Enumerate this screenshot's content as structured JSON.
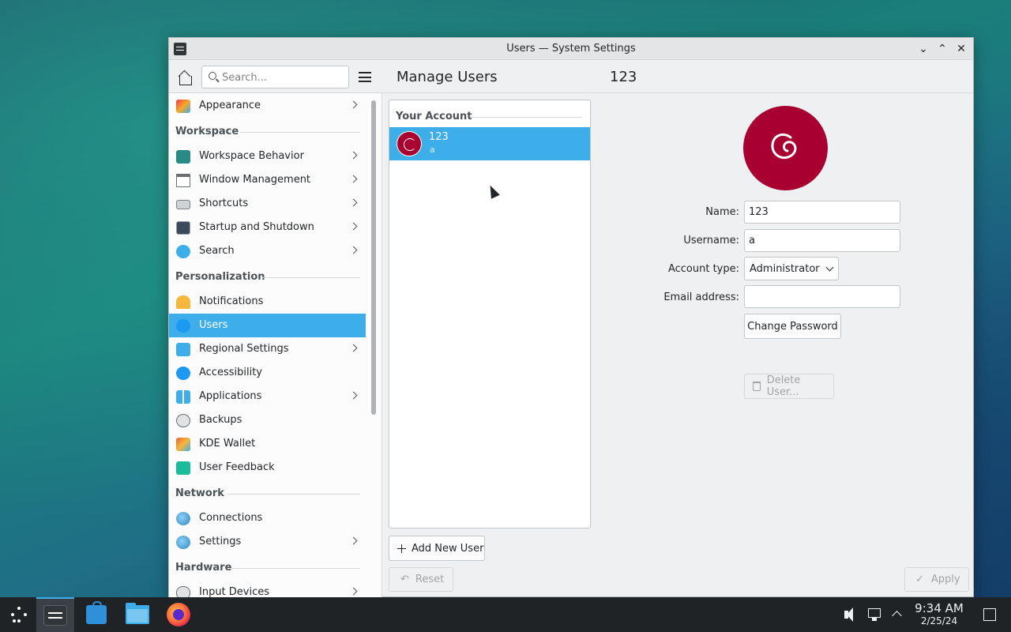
{
  "window": {
    "title": "Users — System Settings",
    "controls": [
      "minimize",
      "maximize",
      "close"
    ]
  },
  "sidebar": {
    "search_placeholder": "Search...",
    "top_items": [
      {
        "label": "Appearance",
        "has_submenu": true
      }
    ],
    "categories": [
      {
        "name": "Workspace",
        "items": [
          {
            "label": "Workspace Behavior",
            "has_submenu": true
          },
          {
            "label": "Window Management",
            "has_submenu": true
          },
          {
            "label": "Shortcuts",
            "has_submenu": true
          },
          {
            "label": "Startup and Shutdown",
            "has_submenu": true
          },
          {
            "label": "Search",
            "has_submenu": true
          }
        ]
      },
      {
        "name": "Personalization",
        "items": [
          {
            "label": "Notifications",
            "has_submenu": false
          },
          {
            "label": "Users",
            "has_submenu": false,
            "selected": true
          },
          {
            "label": "Regional Settings",
            "has_submenu": true
          },
          {
            "label": "Accessibility",
            "has_submenu": false
          },
          {
            "label": "Applications",
            "has_submenu": true
          },
          {
            "label": "Backups",
            "has_submenu": false
          },
          {
            "label": "KDE Wallet",
            "has_submenu": false
          },
          {
            "label": "User Feedback",
            "has_submenu": false
          }
        ]
      },
      {
        "name": "Network",
        "items": [
          {
            "label": "Connections",
            "has_submenu": false
          },
          {
            "label": "Settings",
            "has_submenu": true
          }
        ]
      },
      {
        "name": "Hardware",
        "items": [
          {
            "label": "Input Devices",
            "has_submenu": true
          }
        ]
      }
    ]
  },
  "header": {
    "title": "Manage Users",
    "subtitle": "123"
  },
  "user_list": {
    "section_label": "Your Account",
    "users": [
      {
        "name": "123",
        "username": "a",
        "selected": true
      }
    ],
    "add_button": "Add New User"
  },
  "details": {
    "name_label": "Name:",
    "name_value": "123",
    "username_label": "Username:",
    "username_value": "a",
    "account_type_label": "Account type:",
    "account_type_value": "Administrator",
    "email_label": "Email address:",
    "email_value": "",
    "change_password": "Change Password",
    "delete_user": "Delete User..."
  },
  "footer": {
    "reset": "Reset",
    "apply": "Apply"
  },
  "taskbar": {
    "apps": [
      "application-launcher-icon",
      "system-settings-icon",
      "discover-icon",
      "file-manager-icon",
      "firefox-icon"
    ],
    "time": "9:34 AM",
    "date": "2/25/24"
  },
  "colors": {
    "accent": "#3daee9",
    "debian_red": "#a80030",
    "taskbar": "#202326"
  }
}
